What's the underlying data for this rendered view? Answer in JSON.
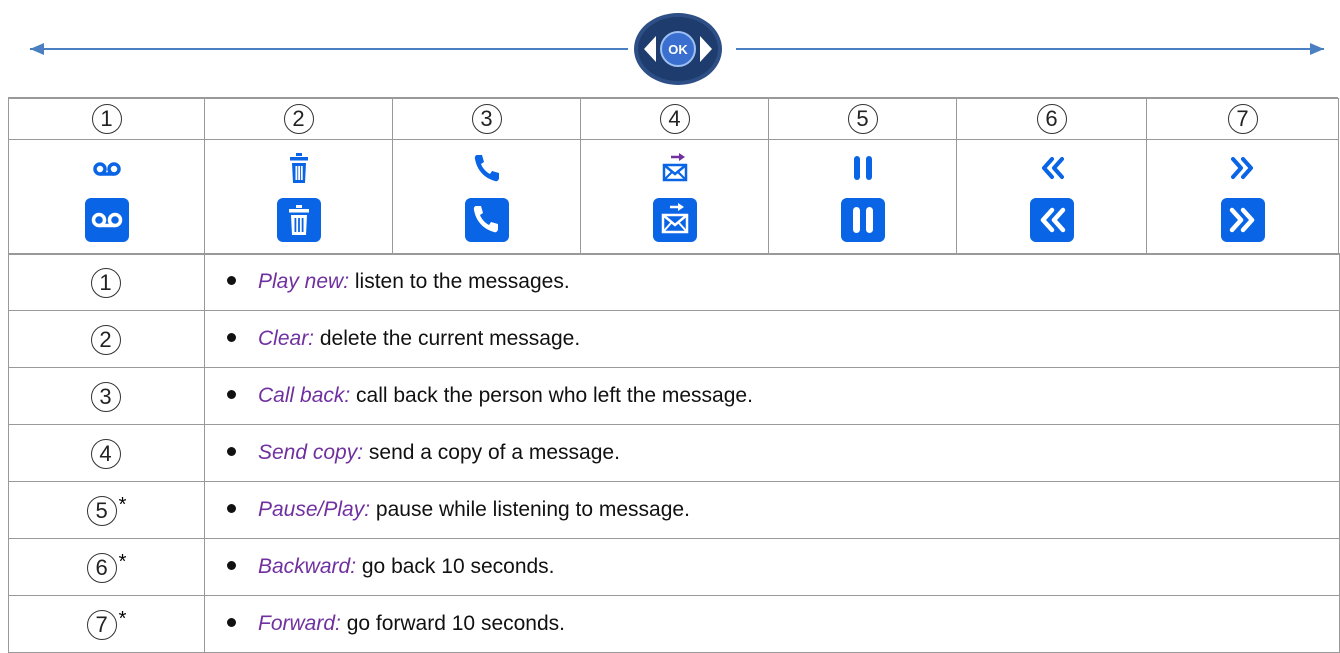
{
  "nav": {
    "ok_label": "OK"
  },
  "columns": [
    {
      "num": "1",
      "icon": "voicemail-icon"
    },
    {
      "num": "2",
      "icon": "trash-icon"
    },
    {
      "num": "3",
      "icon": "phone-icon"
    },
    {
      "num": "4",
      "icon": "send-mail-icon"
    },
    {
      "num": "5",
      "icon": "pause-icon"
    },
    {
      "num": "6",
      "icon": "rewind-icon"
    },
    {
      "num": "7",
      "icon": "forward-icon"
    }
  ],
  "rows": [
    {
      "num": "1",
      "star": "",
      "term": "Play new:",
      "text": " listen to the messages."
    },
    {
      "num": "2",
      "star": "",
      "term": "Clear:",
      "text": " delete the current message."
    },
    {
      "num": "3",
      "star": "",
      "term": "Call back:",
      "text": " call back the person who left the message."
    },
    {
      "num": "4",
      "star": "",
      "term": "Send copy:",
      "text": " send a copy of a message."
    },
    {
      "num": "5",
      "star": "*",
      "term": "Pause/Play:",
      "text": " pause while listening to message."
    },
    {
      "num": "6",
      "star": "*",
      "term": "Backward:",
      "text": " go back 10 seconds."
    },
    {
      "num": "7",
      "star": "*",
      "term": "Forward:",
      "text": " go forward 10 seconds."
    }
  ],
  "colors": {
    "accent": "#0a64e6",
    "term": "#7030a0",
    "arrow": "#4a7fc1"
  }
}
